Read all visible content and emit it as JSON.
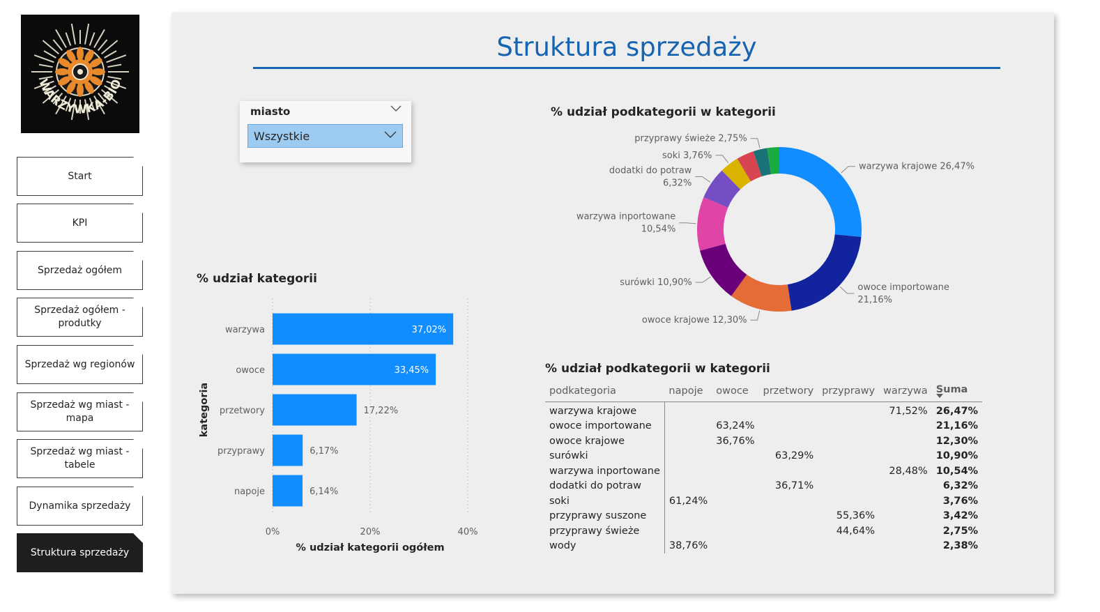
{
  "logo": {
    "text": "WARZYWKA-BIO",
    "icon": "sun-vegetable-logo"
  },
  "nav": {
    "items": [
      {
        "label": "Start"
      },
      {
        "label": "KPI"
      },
      {
        "label": "Sprzedaż ogółem"
      },
      {
        "label": "Sprzedaż ogółem - produtky"
      },
      {
        "label": "Sprzedaż wg regionów"
      },
      {
        "label": "Sprzedaż wg miast - mapa"
      },
      {
        "label": "Sprzedaż wg miast - tabele"
      },
      {
        "label": "Dynamika sprzedaży"
      },
      {
        "label": "Struktura sprzedaży"
      }
    ],
    "active_index": 8
  },
  "page": {
    "title": "Struktura sprzedaży"
  },
  "slicer": {
    "label": "miasto",
    "value": "Wszystkie"
  },
  "colors": {
    "accent": "#1764b0",
    "bar": "#118dff",
    "donut": [
      "#118dff",
      "#12239e",
      "#e66c37",
      "#6b007b",
      "#e044a7",
      "#744ec2",
      "#d9b300",
      "#d64550",
      "#197278",
      "#1aab40"
    ]
  },
  "bar_chart": {
    "title": "% udział kategorii",
    "ylabel": "kategoria",
    "xlabel": "% udział kategorii ogółem",
    "ticks": [
      "0%",
      "20%",
      "40%"
    ]
  },
  "donut_chart": {
    "title": "% udział podkategorii w kategorii"
  },
  "table": {
    "title": "% udział podkategorii w kategorii",
    "columns": [
      "podkategoria",
      "napoje",
      "owoce",
      "przetwory",
      "przyprawy",
      "warzywa",
      "Suma"
    ],
    "rows": [
      [
        "warzywa krajowe",
        "",
        "",
        "",
        "",
        "71,52%",
        "26,47%"
      ],
      [
        "owoce importowane",
        "",
        "63,24%",
        "",
        "",
        "",
        "21,16%"
      ],
      [
        "owoce krajowe",
        "",
        "36,76%",
        "",
        "",
        "",
        "12,30%"
      ],
      [
        "surówki",
        "",
        "",
        "63,29%",
        "",
        "",
        "10,90%"
      ],
      [
        "warzywa inportowane",
        "",
        "",
        "",
        "",
        "28,48%",
        "10,54%"
      ],
      [
        "dodatki do potraw",
        "",
        "",
        "36,71%",
        "",
        "",
        "6,32%"
      ],
      [
        "soki",
        "61,24%",
        "",
        "",
        "",
        "",
        "3,76%"
      ],
      [
        "przyprawy suszone",
        "",
        "",
        "",
        "55,36%",
        "",
        "3,42%"
      ],
      [
        "przyprawy świeże",
        "",
        "",
        "",
        "44,64%",
        "",
        "2,75%"
      ],
      [
        "wody",
        "38,76%",
        "",
        "",
        "",
        "",
        "2,38%"
      ]
    ]
  },
  "chart_data": [
    {
      "type": "bar",
      "title": "% udział kategorii",
      "xlabel": "% udział kategorii ogółem",
      "ylabel": "kategoria",
      "categories": [
        "warzywa",
        "owoce",
        "przetwory",
        "przyprawy",
        "napoje"
      ],
      "values": [
        37.02,
        33.45,
        17.22,
        6.17,
        6.14
      ],
      "labels": [
        "37,02%",
        "33,45%",
        "17,22%",
        "6,17%",
        "6,14%"
      ],
      "xlim": [
        0,
        40
      ],
      "grid": true
    },
    {
      "type": "pie",
      "title": "% udział podkategorii w kategorii",
      "categories": [
        "warzywa krajowe",
        "owoce importowane",
        "owoce krajowe",
        "surówki",
        "warzywa inportowane",
        "dodatki do potraw",
        "soki",
        "przyprawy suszone",
        "przyprawy świeże",
        "wody"
      ],
      "values": [
        26.47,
        21.16,
        12.3,
        10.9,
        10.54,
        6.32,
        3.76,
        3.42,
        2.75,
        2.38
      ],
      "labels": [
        [
          "warzywa krajowe 26,47%"
        ],
        [
          "owoce importowane",
          "21,16%"
        ],
        [
          "owoce krajowe 12,30%"
        ],
        [
          "surówki 10,90%"
        ],
        [
          "warzywa inportowane",
          "10,54%"
        ],
        [
          "dodatki do potraw",
          "6,32%"
        ],
        [
          "soki 3,76%"
        ],
        [],
        [
          "przyprawy świeże 2,75%"
        ],
        []
      ]
    }
  ]
}
